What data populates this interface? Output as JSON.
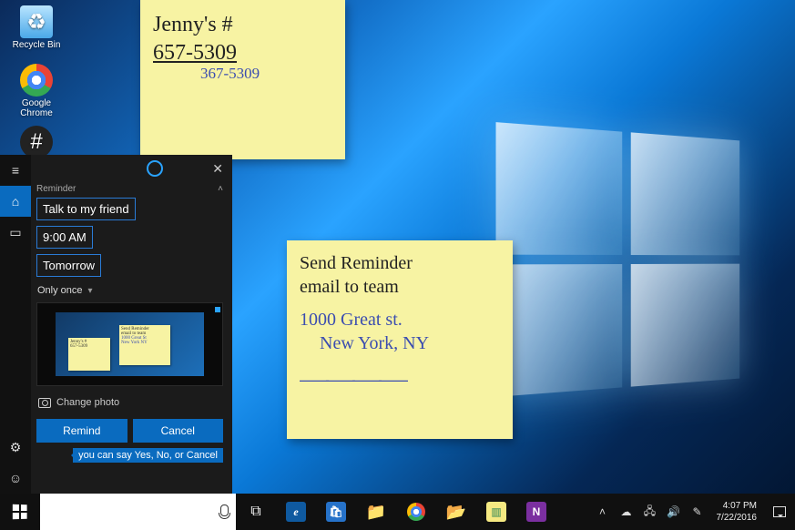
{
  "desktop_icons": {
    "recycle_bin": {
      "label": "Recycle Bin"
    },
    "chrome": {
      "label": "Google Chrome"
    }
  },
  "sticky_notes": {
    "note1": {
      "line1": "Jenny's #",
      "line2": "657-5309",
      "line3_blue": "367-5309"
    },
    "note2": {
      "line1": "Send Reminder",
      "line2": "email to team",
      "addr1_blue": "1000 Great st.",
      "addr2_blue": "New York, NY"
    }
  },
  "cortana": {
    "section_label": "Reminder",
    "subject": "Talk to my friend",
    "time": "9:00 AM",
    "day": "Tomorrow",
    "repeat": "Only once",
    "change_photo": "Change photo",
    "remind_btn": "Remind",
    "cancel_btn": "Cancel",
    "hint": "you can say Yes, No, or Cancel"
  },
  "taskbar": {
    "apps": {
      "taskview": "⧉",
      "edge": "e",
      "store": "🛍",
      "explorer": "📁",
      "chrome": "●",
      "folder": "📂",
      "sticky": "▥",
      "onenote": "N"
    },
    "tray": {
      "chevron": "˄",
      "onedrive": "☁",
      "net": "🖧",
      "sound": "🔊",
      "pen": "✎"
    },
    "clock": {
      "time": "4:07 PM",
      "date": "7/22/2016"
    }
  }
}
